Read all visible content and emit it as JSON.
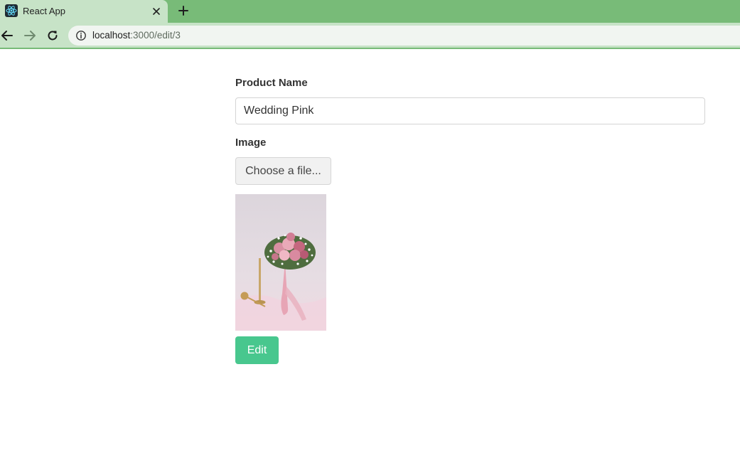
{
  "browser": {
    "tab_title": "React App",
    "url_host": "localhost",
    "url_path": ":3000/edit/3"
  },
  "form": {
    "name_label": "Product Name",
    "name_value": "Wedding Pink",
    "image_label": "Image",
    "file_button_label": "Choose a file...",
    "submit_label": "Edit"
  },
  "colors": {
    "tabstrip": "#78bb78",
    "toolbar": "#c7e3c7",
    "submit_button": "#48c78e"
  },
  "icons": {
    "favicon": "react-logo-icon",
    "tab_close": "close-icon",
    "new_tab": "plus-icon",
    "back": "arrow-left-icon",
    "forward": "arrow-right-icon",
    "reload": "reload-icon",
    "site_info": "info-icon"
  }
}
